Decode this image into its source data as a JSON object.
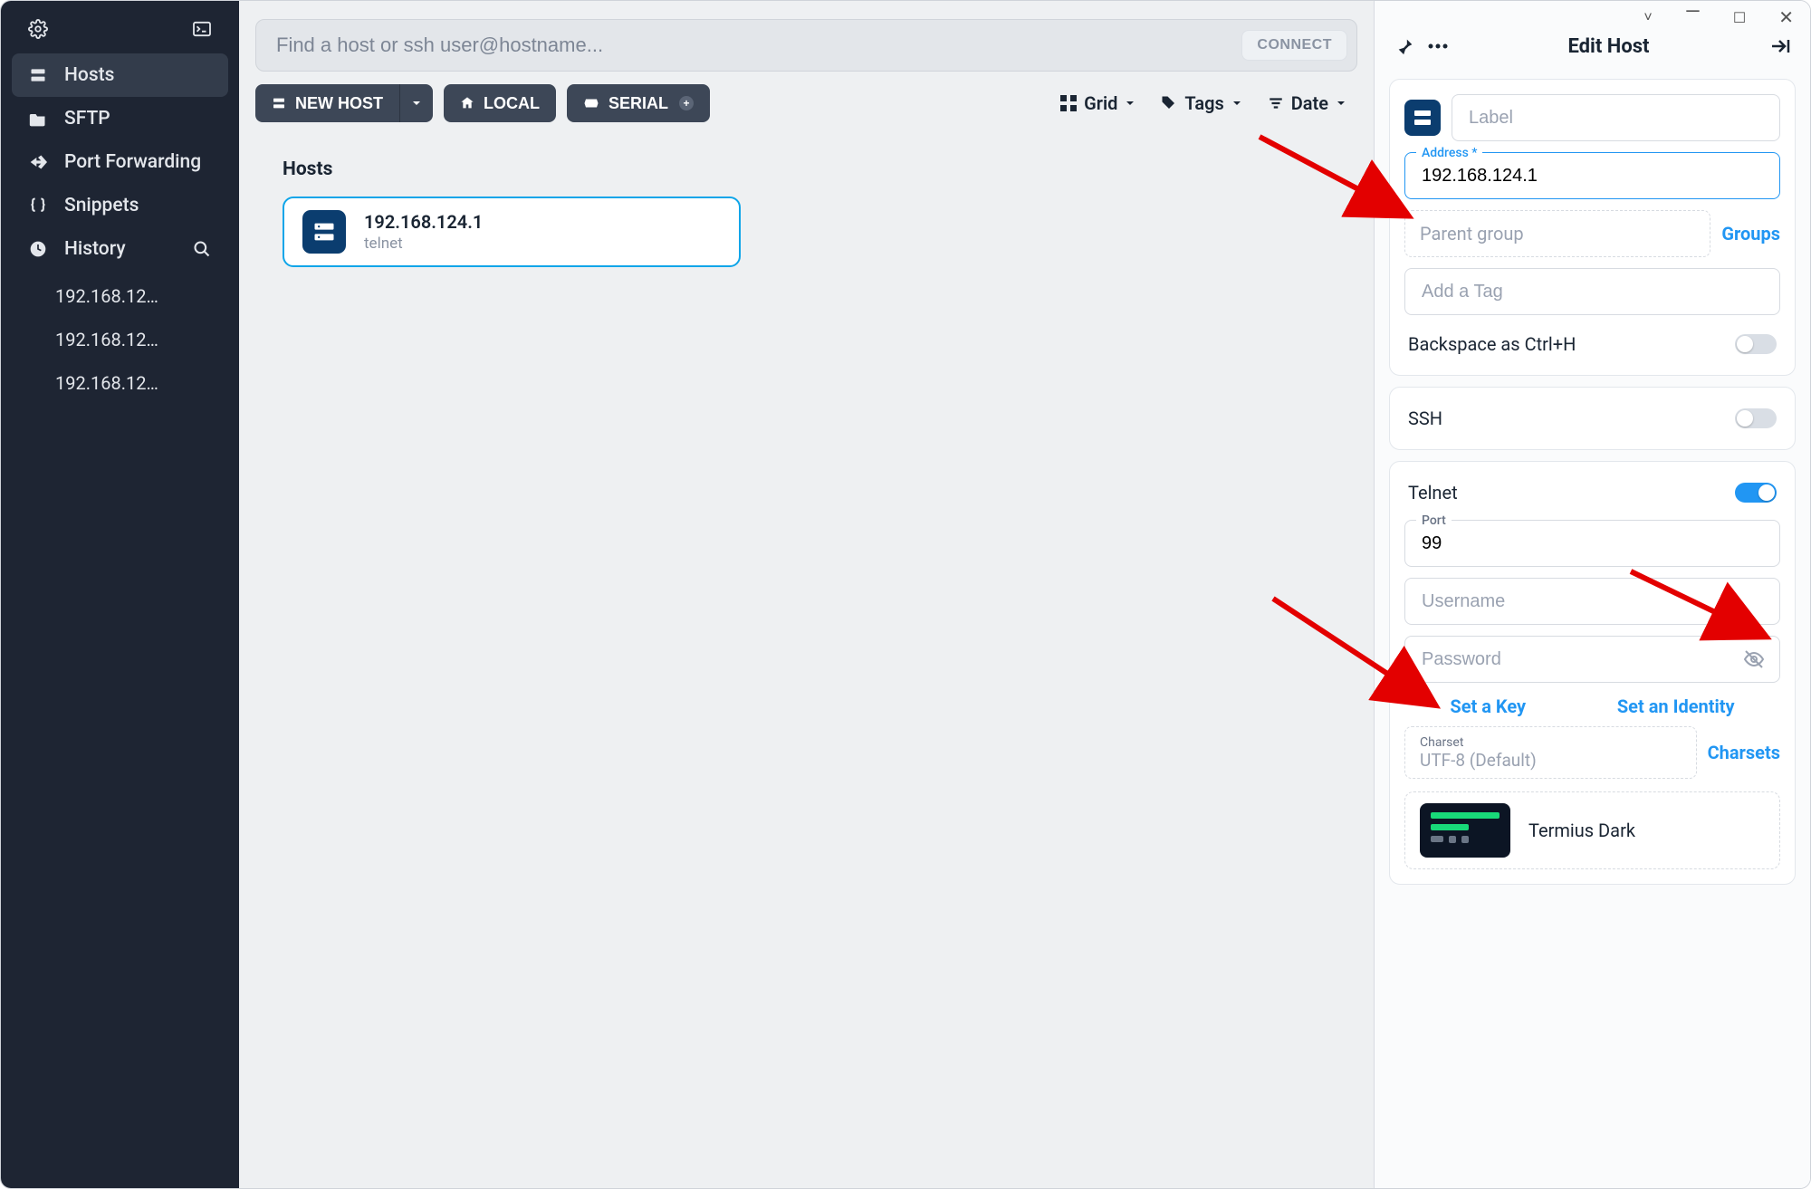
{
  "sidebar": {
    "items": [
      {
        "label": "Hosts"
      },
      {
        "label": "SFTP"
      },
      {
        "label": "Port Forwarding"
      },
      {
        "label": "Snippets"
      },
      {
        "label": "History"
      }
    ],
    "history": [
      "192.168.12…",
      "192.168.12…",
      "192.168.12…"
    ]
  },
  "search": {
    "placeholder": "Find a host or ssh user@hostname...",
    "connect": "CONNECT"
  },
  "toolbar": {
    "new_host": "NEW HOST",
    "local": "LOCAL",
    "serial": "SERIAL",
    "grid": "Grid",
    "tags": "Tags",
    "date": "Date"
  },
  "main": {
    "section_title": "Hosts",
    "host": {
      "title": "192.168.124.1",
      "sub": "telnet"
    }
  },
  "panel": {
    "title": "Edit Host",
    "label_placeholder": "Label",
    "address_label": "Address *",
    "address_value": "192.168.124.1",
    "parent_group_placeholder": "Parent group",
    "groups_link": "Groups",
    "tag_placeholder": "Add a Tag",
    "backspace_label": "Backspace as Ctrl+H",
    "ssh_label": "SSH",
    "telnet": {
      "label": "Telnet",
      "port_label": "Port",
      "port_value": "99",
      "username_placeholder": "Username",
      "password_placeholder": "Password",
      "set_key": "Set a Key",
      "set_identity": "Set an Identity",
      "charset_label": "Charset",
      "charset_value": "UTF-8 (Default)",
      "charsets_link": "Charsets",
      "theme": "Termius Dark"
    }
  }
}
